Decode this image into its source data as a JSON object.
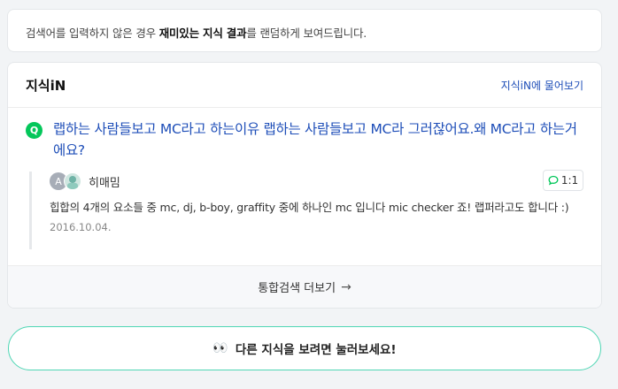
{
  "notice": {
    "prefix": "검색어를 입력하지 않은 경우 ",
    "bold": "재미있는 지식 결과",
    "suffix": "를 랜덤하게 보여드립니다."
  },
  "card": {
    "title": "지식iN",
    "ask_link": "지식iN에 물어보기",
    "question": {
      "badge": "Q",
      "title": "랩하는 사람들보고 MC라고 하는이유 랩하는 사람들보고 MC라 그러잖어요.왜 MC라고 하는거에요?"
    },
    "answer": {
      "avatar_letter": "A",
      "nickname": "히매밈",
      "comment_count": "1:1",
      "text": "힙합의 4개의 요소들 중 mc, dj, b-boy, graffity 중에 하나인 mc 입니다 mic checker 죠! 랩퍼라고도 합니다 :)",
      "date": "2016.10.04."
    },
    "more_label": "통합검색 더보기",
    "more_arrow": "→"
  },
  "cta": {
    "emoji": "👀",
    "label": "다른 지식을 보려면 눌러보세요!"
  },
  "colors": {
    "accent_green": "#03c75a",
    "link_blue": "#1e4eb8",
    "cta_border": "#4fd6b4"
  }
}
